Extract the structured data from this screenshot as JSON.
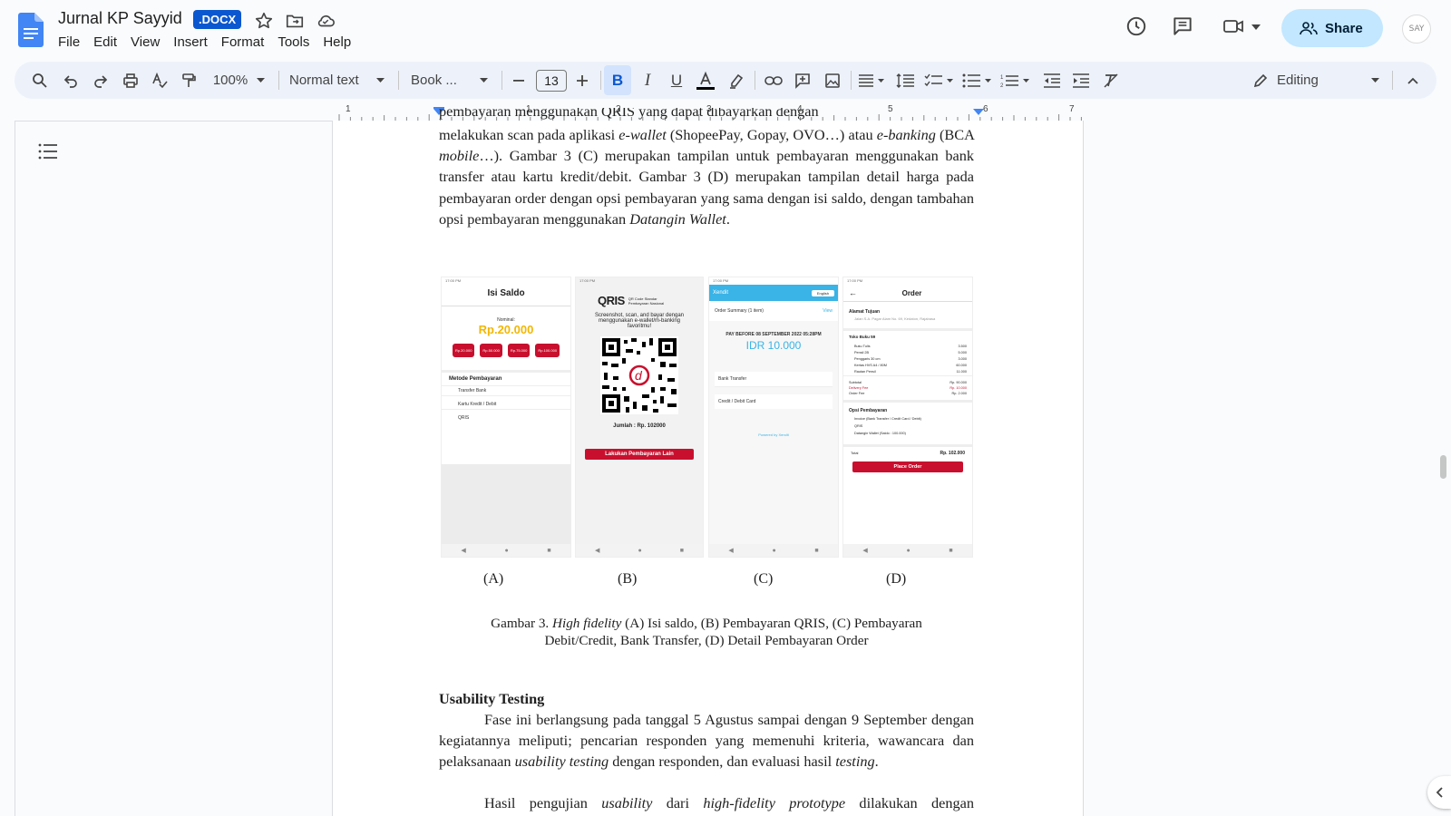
{
  "app": {
    "title": "Jurnal KP Sayyid",
    "badge": ".DOCX"
  },
  "menu": [
    "File",
    "Edit",
    "View",
    "Insert",
    "Format",
    "Tools",
    "Help"
  ],
  "header": {
    "share_label": "Share",
    "avatar_text": "SAY"
  },
  "toolbar": {
    "zoom": "100%",
    "style": "Normal text",
    "font": "Book ...",
    "font_size": "13",
    "mode": "Editing",
    "colors": {
      "accent": "#0b57d0",
      "share_bg": "#c2e7ff",
      "toolbar_bg": "#edf2fa",
      "bold_active": "#d3e3fd"
    }
  },
  "ruler": [
    "1",
    "1",
    "2",
    "3",
    "4",
    "5",
    "6",
    "7"
  ],
  "document": {
    "para1_top": "pembayaran menggunakan QRIS yang dapat dibayarkan dengan",
    "para1_a": "melakukan scan pada aplikasi ",
    "para1_a_i": "e-wallet",
    "para1_b": " (ShopeePay, Gopay, OVO…) atau ",
    "para1_c_i": "e-banking",
    "para1_d": " (BCA ",
    "para1_e_i": "mobile",
    "para1_f": "…). Gambar 3 (C) merupakan tampilan untuk pembayaran menggunakan bank transfer atau kartu kredit/debit. Gambar 3 (D) merupakan tampilan detail harga pada pembayaran order dengan opsi pembayaran yang sama dengan isi saldo, dengan tambahan opsi pembayaran menggunakan ",
    "para1_g_i": "Datangin Wallet",
    "para1_h": ".",
    "labels": [
      "(A)",
      "(B)",
      "(C)",
      "(D)"
    ],
    "caption_a": "Gambar 3. ",
    "caption_b_i": "High fidelity",
    "caption_c": " (A) Isi saldo, (B) Pembayaran QRIS, (C) Pembayaran",
    "caption_line2": "Debit/Credit, Bank Transfer, (D) Detail Pembayaran Order",
    "heading": "Usability Testing",
    "para2_a": "Fase ini berlangsung pada tanggal 5 Agustus sampai dengan 9 September dengan kegiatannya meliputi; pencarian responden yang memenuhi kriteria, wawancara dan pelaksanaan ",
    "para2_b_i": "usability testing",
    "para2_c": " dengan responden, dan evaluasi hasil ",
    "para2_d_i": "testing",
    "para2_e": ".",
    "para3_a": "Hasil pengujian ",
    "para3_b_i": "usability",
    "para3_c": " dari ",
    "para3_d_i": "high-fidelity prototype",
    "para3_e": " dilakukan dengan"
  },
  "screens": {
    "a": {
      "title": "Isi Saldo",
      "nominal_label": "Nominal:",
      "nominal": "Rp.20.000",
      "chips": [
        "Rp.20.000",
        "Rp.50.000",
        "Rp.75.000",
        "Rp.100.000"
      ],
      "method_title": "Metode Pembayaran",
      "methods": [
        "Transfer Bank",
        "Kartu Kredit / Debit",
        "QRIS"
      ]
    },
    "b": {
      "logo": "QRIS",
      "logo_sub": "QR Code Standar Pembayaran Nasional",
      "desc": "Screenshot, scan, and bayar dengan menggunakan e-wallet/m-banking favoritmu!",
      "amount": "Jumlah : Rp. 102000",
      "button": "Lakukan Pembayaran Lain"
    },
    "c": {
      "brand": "Xendit",
      "lang": "English",
      "summary": "Order Summary (1 item)",
      "view": "View",
      "pay_before": "PAY BEFORE 08 SEPTEMBER 2022 05:28PM",
      "amount": "IDR 10.000",
      "options": [
        "Bank Transfer",
        "Credit / Debit Card"
      ],
      "footer": "Powered by Xendit"
    },
    "d": {
      "title": "Order",
      "addr_title": "Alamat Tujuan",
      "addr": "Jalan S.A. Pagar Alam No. 69, Kedaton, Rajabasa",
      "shop": "Toko Buku 59",
      "items": [
        "Buku Tulis",
        "Pensil 2B",
        "Penggaris 30 cm",
        "Kertas HVS A4 / 80M",
        "Rautan Pensil"
      ],
      "prices": [
        "3.500",
        "5.000",
        "3.000",
        "60.000",
        "11.000"
      ],
      "summary": [
        "Subtotal",
        "Delivery Fee",
        "Order Fee"
      ],
      "summary_vals": [
        "Rp. 90.000",
        "Rp. 10.000",
        "Rp. 2.000"
      ],
      "opsi_title": "Opsi Pembayaran",
      "opsi": [
        "Invoice (Bank Transfer / Credit Card / Debit)",
        "QRIS",
        "Datangin Wallet (Saldo : 100.000)"
      ],
      "total_label": "Total",
      "total": "Rp. 102.000",
      "button": "Place Order"
    }
  }
}
